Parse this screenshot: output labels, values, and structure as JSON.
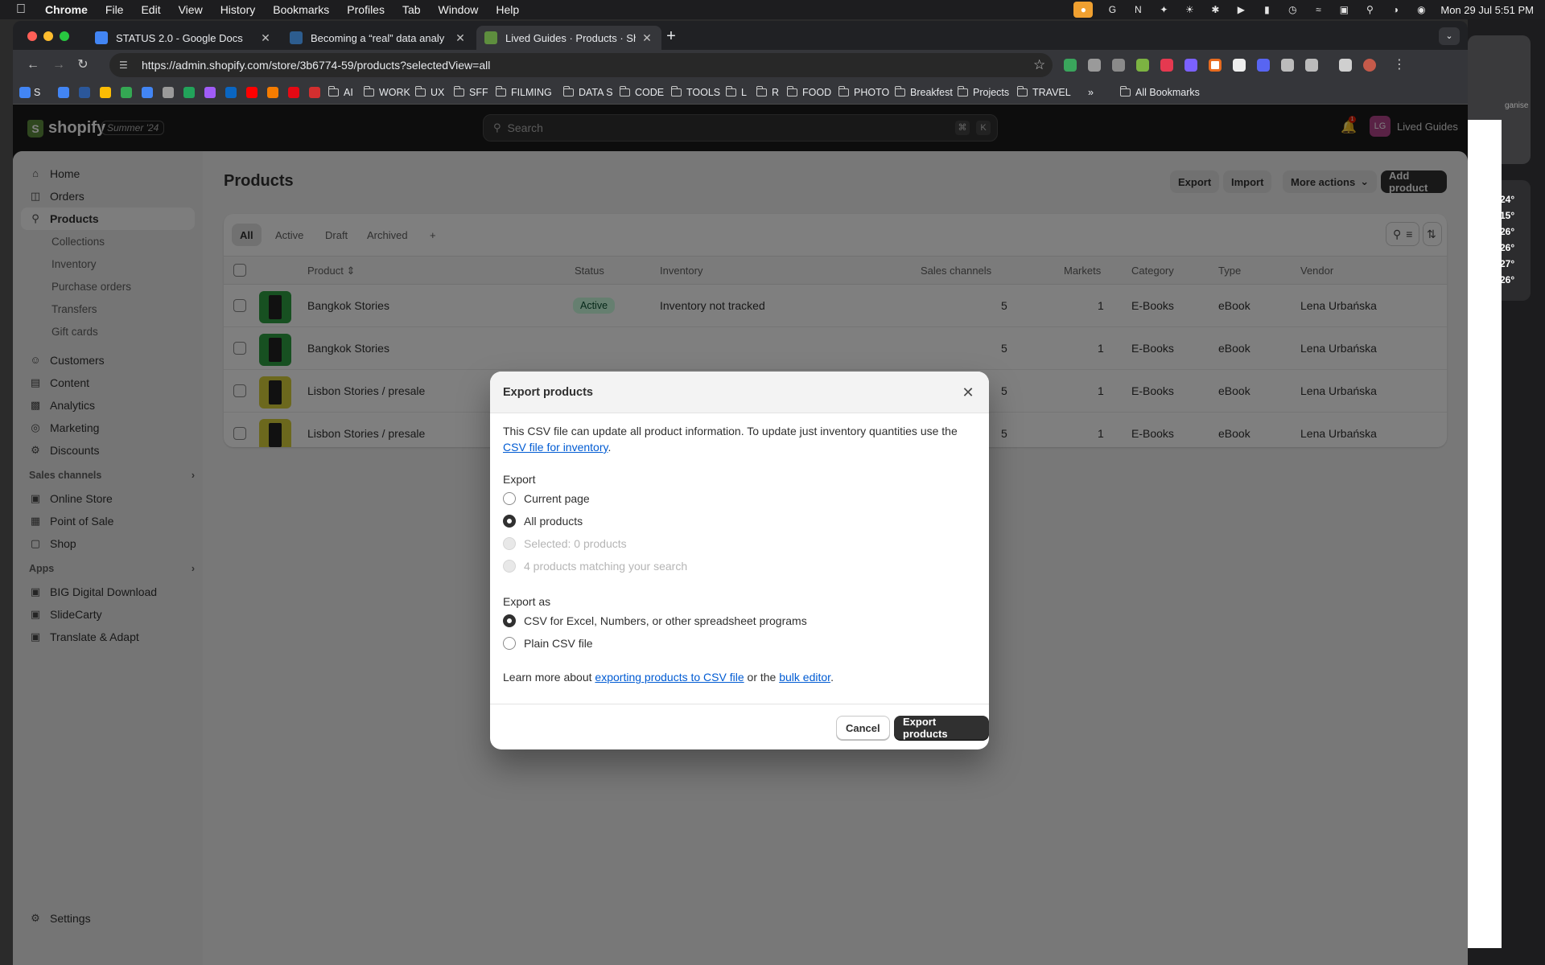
{
  "menubar": {
    "app": "Chrome",
    "items": [
      "File",
      "Edit",
      "View",
      "History",
      "Bookmarks",
      "Profiles",
      "Tab",
      "Window",
      "Help"
    ],
    "clock": "Mon 29 Jul  5:51 PM"
  },
  "tabs": [
    {
      "label": "STATUS 2.0 - Google Docs",
      "favicon_color": "#4285f4"
    },
    {
      "label": "Becoming a “real” data analy",
      "favicon_color": "#2d5d8f"
    },
    {
      "label": "Lived Guides · Products · Sho",
      "favicon_color": "#5e8e3e"
    }
  ],
  "omnibox": {
    "url": "https://admin.shopify.com/store/3b6774-59/products?selectedView=all"
  },
  "bookmarks": {
    "first": "S",
    "folders": [
      "AI",
      "WORK",
      "UX",
      "SFF",
      "FILMING",
      "DATA S",
      "CODE",
      "TOOLS",
      "L",
      "R",
      "FOOD",
      "PHOTO",
      "Breakfest",
      "Projects",
      "TRAVEL"
    ],
    "all": "All Bookmarks"
  },
  "weather": [
    "24°",
    "15°",
    "26°",
    "26°",
    "27°",
    "26°"
  ],
  "desk_right_label": "ganise",
  "shopify": {
    "brand": "shopify",
    "edition": "Summer '24",
    "search_placeholder": "Search",
    "kbd": [
      "⌘",
      "K"
    ],
    "notification_count": "1",
    "account_initials": "LG",
    "account_name": "Lived Guides"
  },
  "sidebar": {
    "main": [
      {
        "label": "Home",
        "icon": "home-icon"
      },
      {
        "label": "Orders",
        "icon": "orders-icon"
      },
      {
        "label": "Products",
        "icon": "products-tag-icon"
      }
    ],
    "products_sub": [
      "Collections",
      "Inventory",
      "Purchase orders",
      "Transfers",
      "Gift cards"
    ],
    "main2": [
      {
        "label": "Customers",
        "icon": "customers-icon"
      },
      {
        "label": "Content",
        "icon": "content-icon"
      },
      {
        "label": "Analytics",
        "icon": "analytics-icon"
      },
      {
        "label": "Marketing",
        "icon": "marketing-icon"
      },
      {
        "label": "Discounts",
        "icon": "discounts-icon"
      }
    ],
    "sales_channels_header": "Sales channels",
    "sales_channels": [
      "Online Store",
      "Point of Sale",
      "Shop"
    ],
    "apps_header": "Apps",
    "apps": [
      "BIG Digital Download",
      "SlideCarty",
      "Translate & Adapt"
    ],
    "settings": "Settings"
  },
  "products_page": {
    "title": "Products",
    "buttons": {
      "export": "Export",
      "import": "Import",
      "more": "More actions",
      "add": "Add product"
    },
    "views": [
      "All",
      "Active",
      "Draft",
      "Archived",
      "+"
    ],
    "columns": [
      "Product",
      "Status",
      "Inventory",
      "Sales channels",
      "Markets",
      "Category",
      "Type",
      "Vendor"
    ],
    "rows": [
      {
        "product": "Bangkok Stories",
        "status": "Active",
        "inventory": "Inventory not tracked",
        "sales_channels": "5",
        "markets": "1",
        "category": "E-Books",
        "type": "eBook",
        "vendor": "Lena Urbańska",
        "thumb_color": "#2ea043"
      },
      {
        "product": "Bangkok Stories",
        "status": "",
        "inventory": "",
        "sales_channels": "5",
        "markets": "1",
        "category": "E-Books",
        "type": "eBook",
        "vendor": "Lena Urbańska",
        "thumb_color": "#2ea043"
      },
      {
        "product": "Lisbon Stories / presale",
        "status": "",
        "inventory": "",
        "sales_channels": "5",
        "markets": "1",
        "category": "E-Books",
        "type": "eBook",
        "vendor": "Lena Urbańska",
        "thumb_color": "#d9d03a"
      },
      {
        "product": "Lisbon Stories / presale",
        "status": "",
        "inventory": "",
        "sales_channels": "5",
        "markets": "1",
        "category": "E-Books",
        "type": "eBook",
        "vendor": "Lena Urbańska",
        "thumb_color": "#d9d03a"
      }
    ]
  },
  "modal": {
    "title": "Export products",
    "intro": "This CSV file can update all product information. To update just inventory quantities use the",
    "intro_link": "CSV file for inventory",
    "export_label": "Export",
    "export_options": [
      {
        "label": "Current page",
        "state": "off"
      },
      {
        "label": "All products",
        "state": "on"
      },
      {
        "label": "Selected: 0 products",
        "state": "disabled"
      },
      {
        "label": "4 products matching your search",
        "state": "disabled"
      }
    ],
    "export_as_label": "Export as",
    "format_options": [
      {
        "label": "CSV for Excel, Numbers, or other spreadsheet programs",
        "state": "on"
      },
      {
        "label": "Plain CSV file",
        "state": "off"
      }
    ],
    "learn_prefix": "Learn more about",
    "learn_link1": "exporting products to CSV file",
    "learn_mid": "or the",
    "learn_link2": "bulk editor",
    "cancel": "Cancel",
    "confirm": "Export products"
  }
}
